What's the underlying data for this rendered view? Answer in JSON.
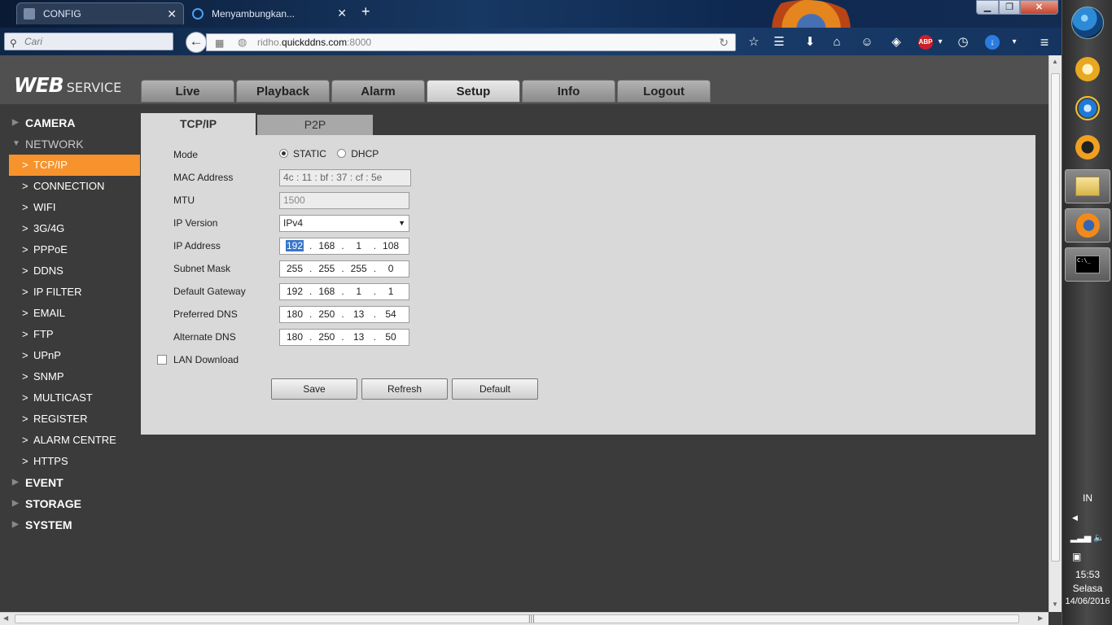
{
  "browser": {
    "tabs": [
      {
        "title": "CONFIG",
        "active": true
      },
      {
        "title": "Menyambungkan...",
        "active": false
      }
    ],
    "search_placeholder": "Cari",
    "url_prefix": "ridho.",
    "url_domain": "quickddns.com",
    "url_suffix": ":8000",
    "abp_label": "ABP"
  },
  "app": {
    "logo_main": "WEB",
    "logo_sub": "SERVICE",
    "main_tabs": [
      "Live",
      "Playback",
      "Alarm",
      "Setup",
      "Info",
      "Logout"
    ],
    "active_main_tab": "Setup"
  },
  "sidebar": {
    "camera": "CAMERA",
    "network": "NETWORK",
    "network_items": [
      "TCP/IP",
      "CONNECTION",
      "WIFI",
      "3G/4G",
      "PPPoE",
      "DDNS",
      "IP FILTER",
      "EMAIL",
      "FTP",
      "UPnP",
      "SNMP",
      "MULTICAST",
      "REGISTER",
      "ALARM CENTRE",
      "HTTPS"
    ],
    "active_item": "TCP/IP",
    "event": "EVENT",
    "storage": "STORAGE",
    "system": "SYSTEM"
  },
  "subtabs": [
    "TCP/IP",
    "P2P"
  ],
  "form": {
    "labels": {
      "mode": "Mode",
      "mac": "MAC Address",
      "mtu": "MTU",
      "ip_version": "IP Version",
      "ip_address": "IP Address",
      "subnet": "Subnet Mask",
      "gateway": "Default Gateway",
      "dns1": "Preferred DNS",
      "dns2": "Alternate DNS",
      "lan_download": "LAN Download"
    },
    "mode_options": [
      "STATIC",
      "DHCP"
    ],
    "mode_selected": "STATIC",
    "mac": [
      "4c",
      "11",
      "bf",
      "37",
      "cf",
      "5e"
    ],
    "mtu": "1500",
    "ip_version": "IPv4",
    "ip_address": [
      "192",
      "168",
      "1",
      "108"
    ],
    "subnet": [
      "255",
      "255",
      "255",
      "0"
    ],
    "gateway": [
      "192",
      "168",
      "1",
      "1"
    ],
    "dns1": [
      "180",
      "250",
      "13",
      "54"
    ],
    "dns2": [
      "180",
      "250",
      "13",
      "50"
    ],
    "lan_download_checked": false,
    "buttons": {
      "save": "Save",
      "refresh": "Refresh",
      "default": "Default"
    }
  },
  "taskbar": {
    "lang": "IN",
    "time": "15:53",
    "day": "Selasa",
    "date": "14/06/2016",
    "cmd_label": "C:\\_"
  }
}
